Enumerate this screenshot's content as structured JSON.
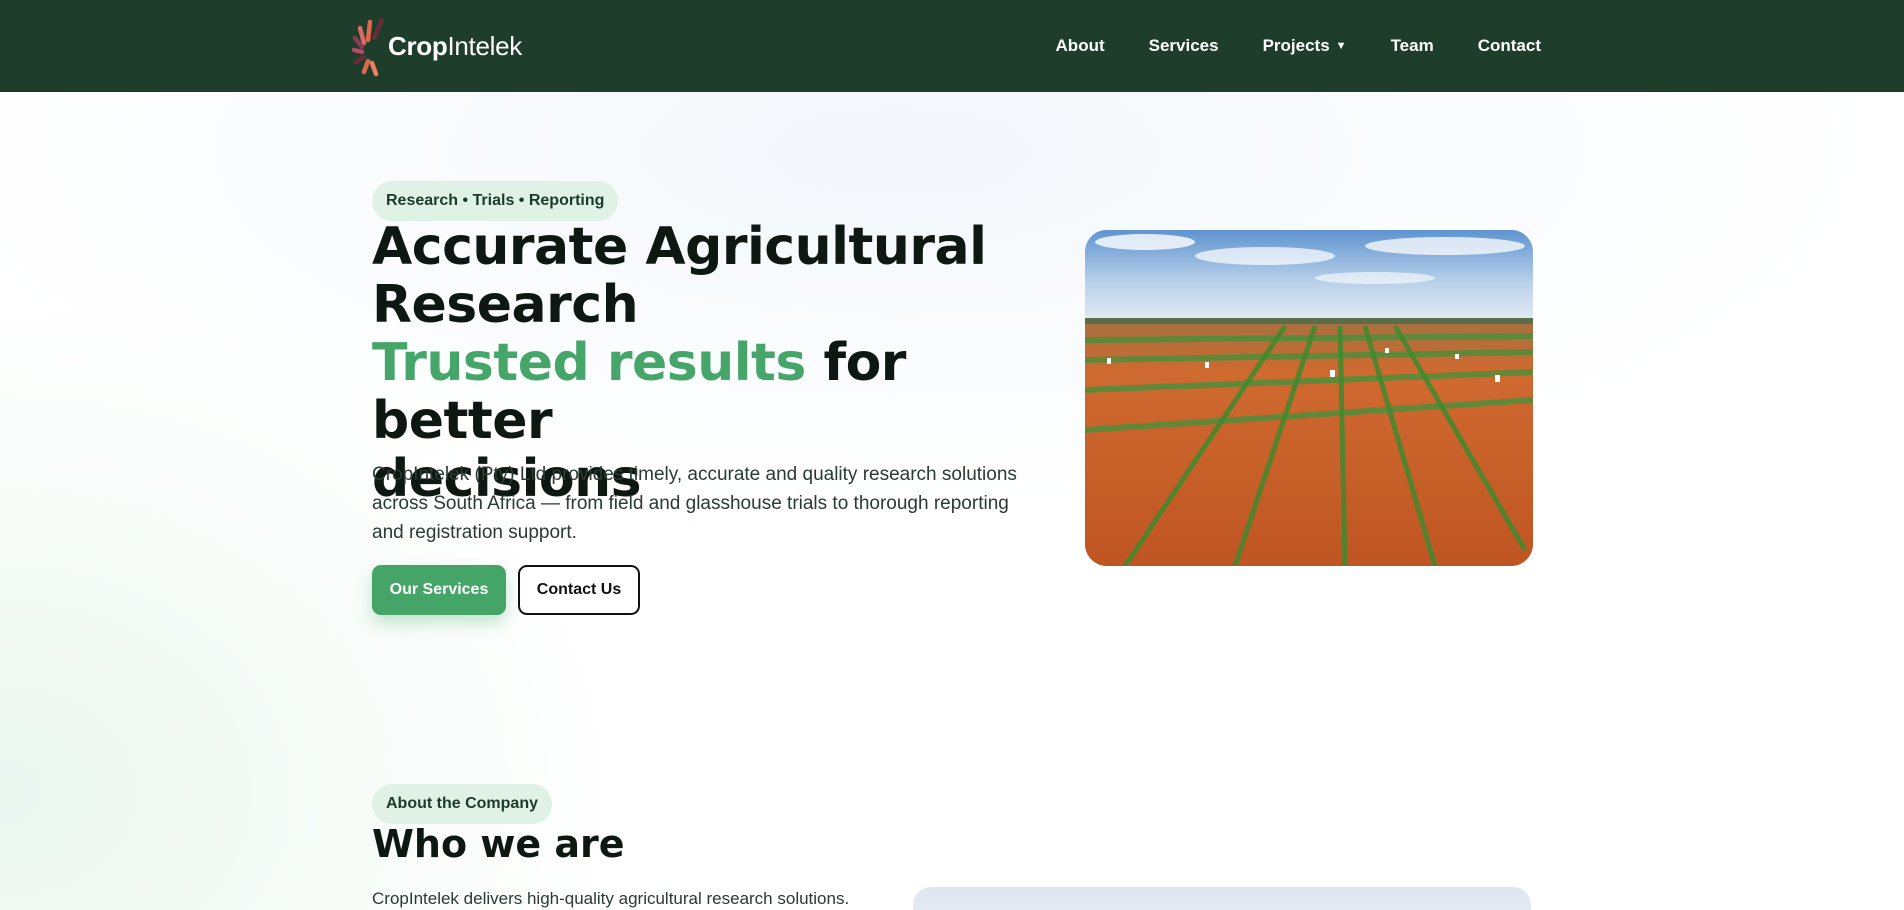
{
  "header": {
    "logo": {
      "bold": "Crop",
      "regular": "Intelek"
    },
    "nav": [
      {
        "label": "About"
      },
      {
        "label": "Services"
      },
      {
        "label": "Projects",
        "has_dropdown": true
      },
      {
        "label": "Team"
      },
      {
        "label": "Contact"
      }
    ],
    "background_color": "#1e3d2a"
  },
  "hero": {
    "pill": "Research • Trials • Reporting",
    "title_line1": "Accurate Agricultural",
    "title_line2": "Research",
    "title_green": "Trusted results",
    "title_rest": " for better",
    "title_line4": "decisions",
    "description": "CropIntelek (Pty) Ltd provides timely, accurate and quality research solutions across South Africa — from field and glasshouse trials to thorough reporting and registration support.",
    "primary_button": "Our Services",
    "secondary_button": "Contact Us",
    "accent_color": "#46a66a"
  },
  "about": {
    "pill": "About the Company",
    "title": "Who we are",
    "description": "CropIntelek delivers high-quality agricultural research solutions."
  }
}
